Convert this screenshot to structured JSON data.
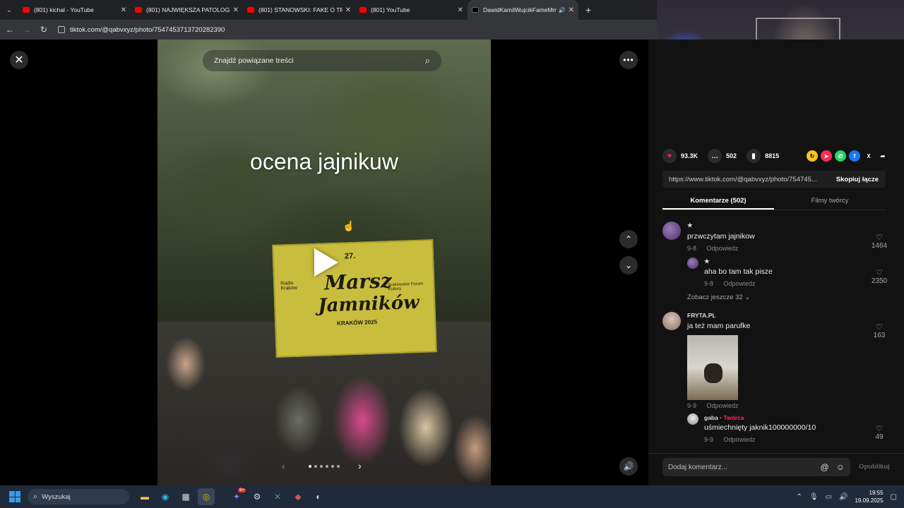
{
  "browser": {
    "tabs": [
      {
        "title": "(801) kichal - YouTube",
        "favicon": "youtube-icon"
      },
      {
        "title": "(801) NAJWIĘKSZA PATOLOGIA",
        "favicon": "youtube-icon"
      },
      {
        "title": "(801) STANOWSKI: FAKE O TRU",
        "favicon": "youtube-icon"
      },
      {
        "title": "(801) YouTube",
        "favicon": "youtube-icon"
      },
      {
        "title": "DawidKamilWujcikFameMm",
        "favicon": "tiktok-icon",
        "active": true
      }
    ],
    "url": "tiktok.com/@qabvxyz/photo/7547453713720282390"
  },
  "viewer": {
    "search_placeholder": "Znajdź powiązane treści",
    "caption": "ocena jajnikuw",
    "banner": {
      "number": "27.",
      "line1": "Marsz",
      "line2": "Jamników",
      "sub": "KRAKÓW 2025",
      "left": "Radio Kraków",
      "right": "Krakowskie Forum Kultury"
    },
    "slides_total": 6,
    "slide_active": 1
  },
  "actions": {
    "likes": "93.3K",
    "comments": "502",
    "saves": "8815",
    "link": "https://www.tiktok.com/@qabvxyz/photo/754745...",
    "copy_label": "Skopiuj łącze"
  },
  "tabs": {
    "comments_label": "Komentarze (502)",
    "creator_label": "Filmy twórcy"
  },
  "comments": [
    {
      "user": "★",
      "text": "przwczytam jajnikow",
      "date": "9-8",
      "reply": "Odpowiedz",
      "likes": "1464"
    },
    {
      "user": "★",
      "text": "aha bo tam tak pisze",
      "date": "9-8",
      "reply": "Odpowiedz",
      "likes": "2350"
    },
    {
      "more": "Zobacz jeszcze 32"
    },
    {
      "user": "FRYTA.PL",
      "text": "ja też mam parufke",
      "date": "9-9",
      "reply": "Odpowiedz",
      "likes": "163"
    },
    {
      "user": "gaba",
      "creator": "Twórca",
      "text": "uśmiechnięty jaknik100000000/10",
      "date": "9-9",
      "reply": "Odpowiedz",
      "likes": "49"
    }
  ],
  "add_comment": {
    "placeholder": "Dodaj komentarz...",
    "post_label": "Opublikuj"
  },
  "taskbar": {
    "search_label": "Wyszukaj",
    "time": "19:55",
    "date": "19.09.2025",
    "badge": "9+"
  },
  "colors": {
    "like_red": "#fe2c55",
    "panel_bg": "#121212",
    "taskbar_bg": "#1f2a3a"
  }
}
